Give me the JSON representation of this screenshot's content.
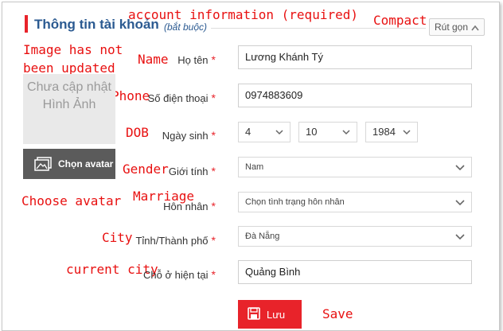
{
  "header": {
    "title": "Thông tin tài khoản",
    "required_note": "(bắt buộc)",
    "collapse_label": "Rút gọn",
    "collapse_icon": "chevron-up-icon"
  },
  "annotations": {
    "account_information": "account information (required)",
    "compact": "Compact",
    "image_not_updated": "Image has not been updated",
    "name": "Name",
    "phone": "Phone",
    "dob": "DOB",
    "gender": "Gender",
    "marriage": "Marriage",
    "choose_avatar": "Choose avatar",
    "city": "City",
    "current_city": "current city",
    "save": "Save"
  },
  "avatar": {
    "placeholder_line1": "Chưa cập nhật",
    "placeholder_line2": "Hình Ảnh",
    "button_label": "Chọn avatar",
    "button_icon": "image-icon"
  },
  "form": {
    "required_mark": "*",
    "name": {
      "label": "Họ tên",
      "value": "Lương Khánh Tý"
    },
    "phone": {
      "label": "Số điện thoại",
      "value": "0974883609"
    },
    "dob": {
      "label": "Ngày sinh",
      "day": "4",
      "month": "10",
      "year": "1984"
    },
    "gender": {
      "label": "Giới tính",
      "value": "Nam"
    },
    "marital": {
      "label": "Hôn nhân",
      "value": "Chọn tình trạng hôn nhân"
    },
    "city": {
      "label": "Tỉnh/Thành phố",
      "value": "Đà Nẵng"
    },
    "current": {
      "label": "Chỗ ở hiện tại",
      "value": "Quảng Bình"
    }
  },
  "save": {
    "label": "Lưu",
    "icon": "save-icon"
  },
  "colors": {
    "accent": "#e8232a",
    "title": "#2b5a91",
    "annotation": "#e81010",
    "avatar_button": "#5b5b5b"
  }
}
